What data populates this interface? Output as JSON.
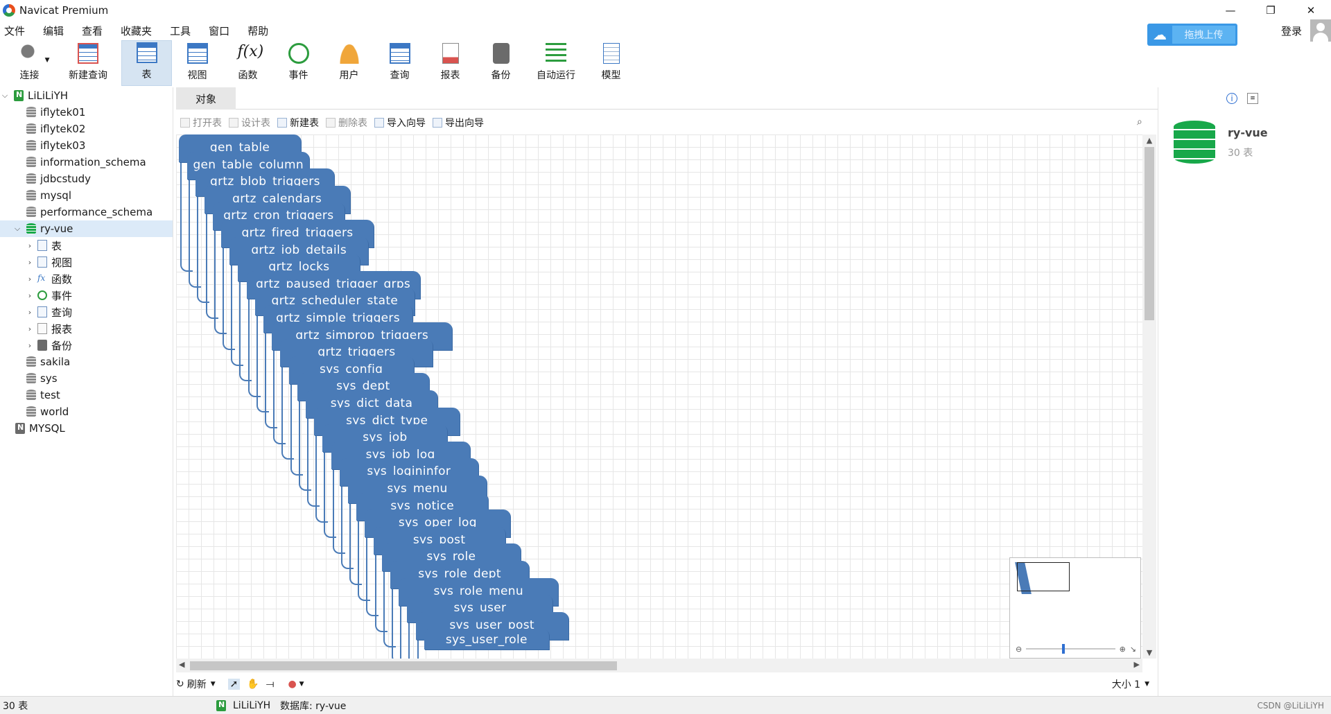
{
  "window": {
    "title": "Navicat Premium",
    "controls": [
      "—",
      "❐",
      "✕"
    ]
  },
  "menu": [
    "文件",
    "编辑",
    "查看",
    "收藏夹",
    "工具",
    "窗口",
    "帮助"
  ],
  "toolbar": {
    "buttons": [
      {
        "label": "连接",
        "icon": "connection-icon"
      },
      {
        "label": "新建查询",
        "icon": "new-query-icon"
      },
      {
        "label": "表",
        "icon": "table-icon",
        "active": true
      },
      {
        "label": "视图",
        "icon": "view-icon"
      },
      {
        "label": "函数",
        "icon": "function-icon"
      },
      {
        "label": "事件",
        "icon": "event-icon"
      },
      {
        "label": "用户",
        "icon": "user-icon"
      },
      {
        "label": "查询",
        "icon": "query-icon"
      },
      {
        "label": "报表",
        "icon": "report-icon"
      },
      {
        "label": "备份",
        "icon": "backup-icon"
      },
      {
        "label": "自动运行",
        "icon": "automation-icon"
      },
      {
        "label": "模型",
        "icon": "model-icon"
      }
    ],
    "cloud_label": "拖拽上传",
    "login_label": "登录"
  },
  "nav": {
    "connection": "LiLiLiYH",
    "databases": [
      "iflytek01",
      "iflytek02",
      "iflytek03",
      "information_schema",
      "jdbcstudy",
      "mysql",
      "performance_schema"
    ],
    "selected_db": "ry-vue",
    "db_children": [
      "表",
      "视图",
      "函数",
      "事件",
      "查询",
      "报表",
      "备份"
    ],
    "databases_after": [
      "sakila",
      "sys",
      "test",
      "world"
    ],
    "connection2": "MYSQL"
  },
  "object_tab": "对象",
  "object_toolbar": [
    {
      "label": "打开表",
      "disabled": true
    },
    {
      "label": "设计表",
      "disabled": true
    },
    {
      "label": "新建表",
      "disabled": false
    },
    {
      "label": "删除表",
      "disabled": true
    },
    {
      "label": "导入向导",
      "disabled": false
    },
    {
      "label": "导出向导",
      "disabled": false
    }
  ],
  "tables": [
    "gen_table",
    "gen_table_column",
    "qrtz_blob_triggers",
    "qrtz_calendars",
    "qrtz_cron_triggers",
    "qrtz_fired_triggers",
    "qrtz_job_details",
    "qrtz_locks",
    "qrtz_paused_trigger_grps",
    "qrtz_scheduler_state",
    "qrtz_simple_triggers",
    "qrtz_simprop_triggers",
    "qrtz_triggers",
    "sys_config",
    "sys_dept",
    "sys_dict_data",
    "sys_dict_type",
    "sys_job",
    "sys_job_log",
    "sys_logininfor",
    "sys_menu",
    "sys_notice",
    "sys_oper_log",
    "sys_post",
    "sys_role",
    "sys_role_dept",
    "sys_role_menu",
    "sys_user",
    "sys_user_post",
    "sys_user_role"
  ],
  "canvas_bar": {
    "refresh": "刷新",
    "size": "大小 1"
  },
  "info": {
    "db_name": "ry-vue",
    "count": "30 表"
  },
  "status": {
    "count": "30 表",
    "connection": "LiLiLiYH",
    "database": "数据库: ry-vue",
    "watermark": "CSDN @LiLiLiYH"
  }
}
